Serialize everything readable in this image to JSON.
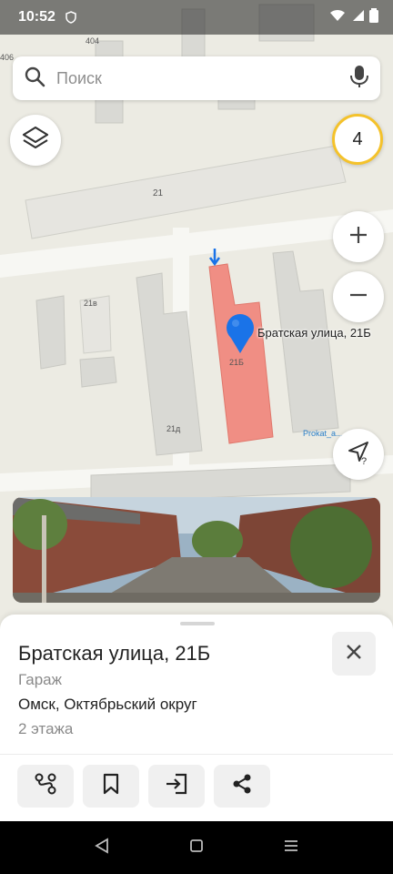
{
  "status_bar": {
    "time": "10:52"
  },
  "search": {
    "placeholder": "Поиск"
  },
  "map": {
    "traffic_level": "4",
    "labels": {
      "house_404": "404",
      "house_406": "406",
      "house_21": "21",
      "house_21v": "21в",
      "house_21b": "21Б",
      "house_21d": "21д",
      "prokat": "Prokat_a..."
    },
    "pin_label": "Братская улица, 21Б"
  },
  "place": {
    "title": "Братская улица, 21Б",
    "type": "Гараж",
    "address": "Омск, Октябрьский округ",
    "floors": "2 этажа"
  },
  "colors": {
    "accent_blue": "#1a73e8",
    "building_highlight": "#f08e84",
    "traffic_yellow": "#f4c22b"
  },
  "icons": {
    "layers": "layers-icon",
    "zoom_in": "plus-icon",
    "zoom_out": "minus-icon",
    "locate": "navigation-arrow-icon",
    "close": "close-icon",
    "route": "route-icon",
    "bookmark": "bookmark-icon",
    "entrance": "entrance-icon",
    "share": "share-icon"
  }
}
